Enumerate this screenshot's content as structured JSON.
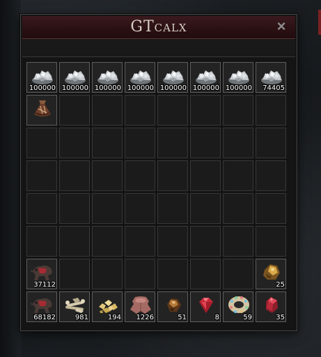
{
  "window": {
    "title": "GTcalx",
    "close_glyph": "×"
  },
  "slots": [
    {
      "row": 0,
      "col": 0,
      "icon": "silver-ore-icon",
      "qty": "100000"
    },
    {
      "row": 0,
      "col": 1,
      "icon": "silver-ore-icon",
      "qty": "100000"
    },
    {
      "row": 0,
      "col": 2,
      "icon": "silver-ore-icon",
      "qty": "100000"
    },
    {
      "row": 0,
      "col": 3,
      "icon": "silver-ore-icon",
      "qty": "100000"
    },
    {
      "row": 0,
      "col": 4,
      "icon": "silver-ore-icon",
      "qty": "100000"
    },
    {
      "row": 0,
      "col": 5,
      "icon": "silver-ore-icon",
      "qty": "100000"
    },
    {
      "row": 0,
      "col": 6,
      "icon": "silver-ore-icon",
      "qty": "100000"
    },
    {
      "row": 0,
      "col": 7,
      "icon": "silver-ore-icon",
      "qty": "74405"
    },
    {
      "row": 1,
      "col": 0,
      "icon": "pouch-icon",
      "qty": ""
    },
    {
      "row": 6,
      "col": 0,
      "icon": "animal-hide-icon",
      "qty": "37112"
    },
    {
      "row": 6,
      "col": 7,
      "icon": "amber-chunk-icon",
      "qty": "25"
    },
    {
      "row": 7,
      "col": 0,
      "icon": "animal-hide-icon",
      "qty": "68182"
    },
    {
      "row": 7,
      "col": 1,
      "icon": "bone-pile-icon",
      "qty": "981"
    },
    {
      "row": 7,
      "col": 2,
      "icon": "gold-nuggets-icon",
      "qty": "194"
    },
    {
      "row": 7,
      "col": 3,
      "icon": "leather-icon",
      "qty": "1226"
    },
    {
      "row": 7,
      "col": 4,
      "icon": "brown-gem-icon",
      "qty": "51"
    },
    {
      "row": 7,
      "col": 5,
      "icon": "ruby-gem-icon",
      "qty": "8"
    },
    {
      "row": 7,
      "col": 6,
      "icon": "jeweled-ring-icon",
      "qty": "59"
    },
    {
      "row": 7,
      "col": 7,
      "icon": "red-crystal-icon",
      "qty": "35"
    }
  ],
  "grid": {
    "rows": 8,
    "cols": 8
  }
}
